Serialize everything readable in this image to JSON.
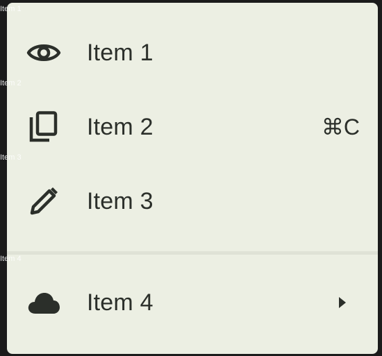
{
  "menu": {
    "items": [
      {
        "label": "Item 1",
        "icon": "eye-icon",
        "shortcut": ""
      },
      {
        "label": "Item 2",
        "icon": "copy-icon",
        "shortcut": "⌘C"
      },
      {
        "label": "Item 3",
        "icon": "pencil-icon",
        "shortcut": ""
      },
      {
        "label": "Item 4",
        "icon": "cloud-icon",
        "submenu_indicator": "caret-right-icon"
      }
    ]
  },
  "ghost_labels": [
    "Item 1",
    "Item 2",
    "Item 3",
    "Item 4"
  ],
  "colors": {
    "menu_background": "#ecefe3",
    "text": "#2b2f2a",
    "backdrop": "#1b1b1b",
    "divider": "#dfe2d6"
  }
}
